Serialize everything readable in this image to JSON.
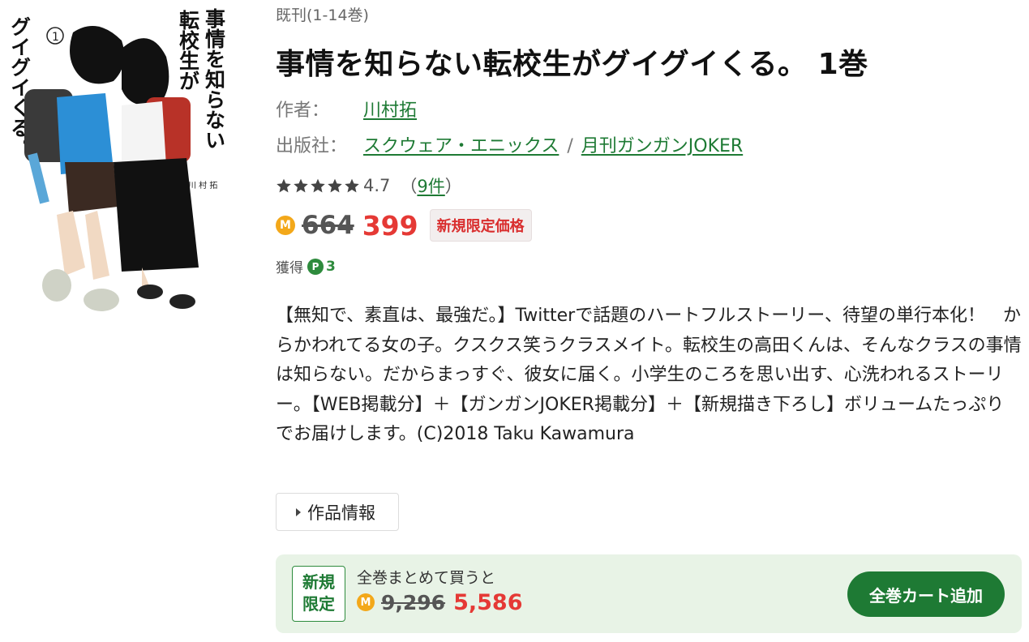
{
  "cover": {
    "title_line1": "事情を知らない",
    "title_line2": "転校生が",
    "title_line3": "グイグイくる。",
    "volume_mark": "1",
    "author_small": "川 村 拓"
  },
  "series": "既刊(1-14巻)",
  "title": "事情を知らない転校生がグイグイくる。 1巻",
  "author": {
    "label": "作者：",
    "name": "川村拓"
  },
  "publisher": {
    "label": "出版社：",
    "name": "スクウェア・エニックス",
    "separator": "/",
    "magazine": "月刊ガンガンJOKER"
  },
  "rating": {
    "score": "4.7",
    "open": "（",
    "count": "9件",
    "close": "）",
    "stars": 5
  },
  "price": {
    "coin": "M",
    "original": "664",
    "sale": "399",
    "badge": "新規限定価格"
  },
  "points": {
    "label": "獲得",
    "coin": "P",
    "value": "3"
  },
  "description": "【無知で、素直は、最強だ。】Twitterで話題のハートフルストーリー、待望の単行本化！　からかわれてる女の子。クスクス笑うクラスメイト。転校生の高田くんは、そんなクラスの事情は知らない。だからまっすぐ、彼女に届く。小学生のころを思い出す、心洗われるストーリー。【WEB掲載分】＋【ガンガンJOKER掲載分】＋【新規描き下ろし】ボリュームたっぷりでお届けします。(C)2018 Taku Kawamura",
  "work_info_button": "作品情報",
  "bulk": {
    "badge_line1": "新規",
    "badge_line2": "限定",
    "label": "全巻まとめて買うと",
    "coin": "M",
    "original": "9,296",
    "sale": "5,586",
    "cart_button": "全巻カート追加"
  },
  "colors": {
    "accent": "#1e7a34",
    "sale": "#e53935",
    "coin": "#f3a81a"
  }
}
